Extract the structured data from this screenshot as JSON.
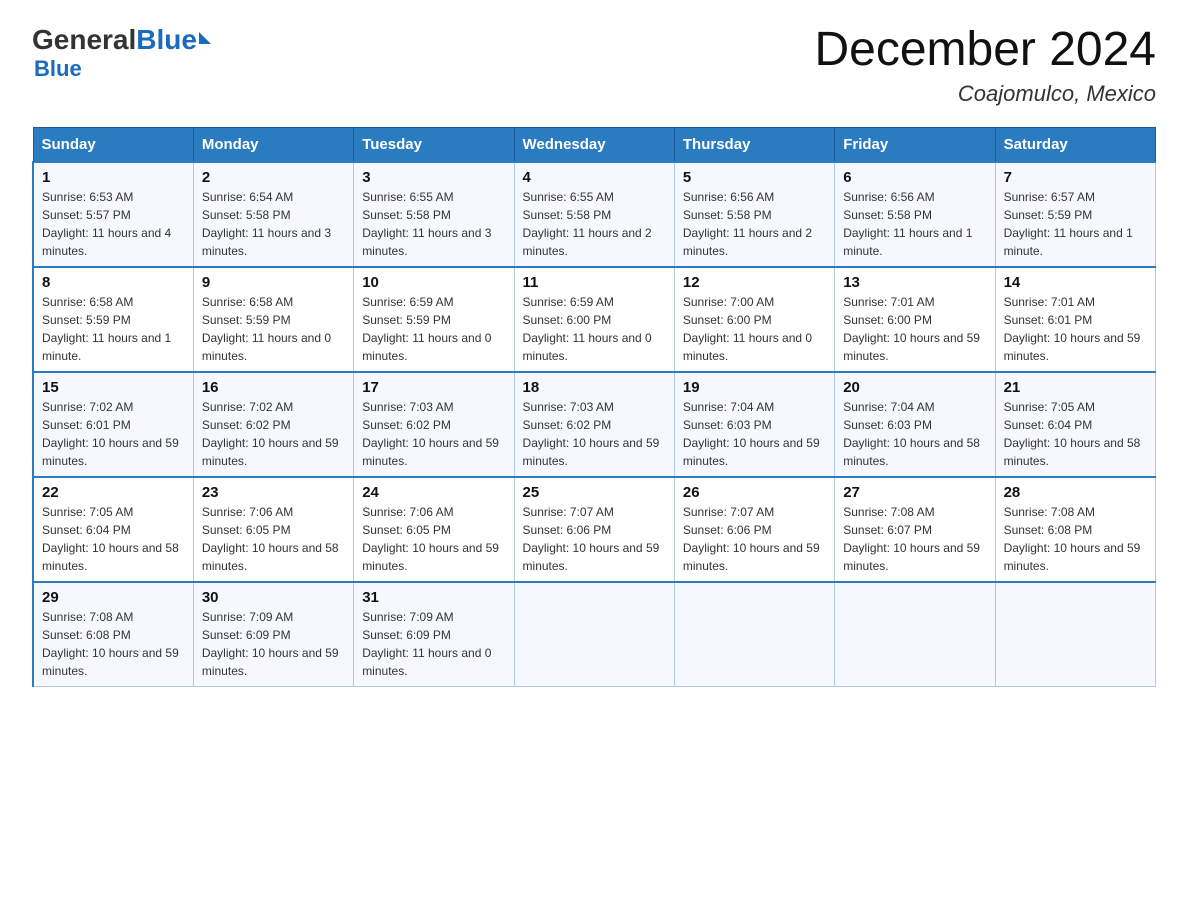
{
  "header": {
    "logo": {
      "general": "General",
      "blue": "Blue"
    },
    "title": "December 2024",
    "location": "Coajomulco, Mexico"
  },
  "days_of_week": [
    "Sunday",
    "Monday",
    "Tuesday",
    "Wednesday",
    "Thursday",
    "Friday",
    "Saturday"
  ],
  "weeks": [
    [
      {
        "day": "1",
        "sunrise": "6:53 AM",
        "sunset": "5:57 PM",
        "daylight": "11 hours and 4 minutes."
      },
      {
        "day": "2",
        "sunrise": "6:54 AM",
        "sunset": "5:58 PM",
        "daylight": "11 hours and 3 minutes."
      },
      {
        "day": "3",
        "sunrise": "6:55 AM",
        "sunset": "5:58 PM",
        "daylight": "11 hours and 3 minutes."
      },
      {
        "day": "4",
        "sunrise": "6:55 AM",
        "sunset": "5:58 PM",
        "daylight": "11 hours and 2 minutes."
      },
      {
        "day": "5",
        "sunrise": "6:56 AM",
        "sunset": "5:58 PM",
        "daylight": "11 hours and 2 minutes."
      },
      {
        "day": "6",
        "sunrise": "6:56 AM",
        "sunset": "5:58 PM",
        "daylight": "11 hours and 1 minute."
      },
      {
        "day": "7",
        "sunrise": "6:57 AM",
        "sunset": "5:59 PM",
        "daylight": "11 hours and 1 minute."
      }
    ],
    [
      {
        "day": "8",
        "sunrise": "6:58 AM",
        "sunset": "5:59 PM",
        "daylight": "11 hours and 1 minute."
      },
      {
        "day": "9",
        "sunrise": "6:58 AM",
        "sunset": "5:59 PM",
        "daylight": "11 hours and 0 minutes."
      },
      {
        "day": "10",
        "sunrise": "6:59 AM",
        "sunset": "5:59 PM",
        "daylight": "11 hours and 0 minutes."
      },
      {
        "day": "11",
        "sunrise": "6:59 AM",
        "sunset": "6:00 PM",
        "daylight": "11 hours and 0 minutes."
      },
      {
        "day": "12",
        "sunrise": "7:00 AM",
        "sunset": "6:00 PM",
        "daylight": "11 hours and 0 minutes."
      },
      {
        "day": "13",
        "sunrise": "7:01 AM",
        "sunset": "6:00 PM",
        "daylight": "10 hours and 59 minutes."
      },
      {
        "day": "14",
        "sunrise": "7:01 AM",
        "sunset": "6:01 PM",
        "daylight": "10 hours and 59 minutes."
      }
    ],
    [
      {
        "day": "15",
        "sunrise": "7:02 AM",
        "sunset": "6:01 PM",
        "daylight": "10 hours and 59 minutes."
      },
      {
        "day": "16",
        "sunrise": "7:02 AM",
        "sunset": "6:02 PM",
        "daylight": "10 hours and 59 minutes."
      },
      {
        "day": "17",
        "sunrise": "7:03 AM",
        "sunset": "6:02 PM",
        "daylight": "10 hours and 59 minutes."
      },
      {
        "day": "18",
        "sunrise": "7:03 AM",
        "sunset": "6:02 PM",
        "daylight": "10 hours and 59 minutes."
      },
      {
        "day": "19",
        "sunrise": "7:04 AM",
        "sunset": "6:03 PM",
        "daylight": "10 hours and 59 minutes."
      },
      {
        "day": "20",
        "sunrise": "7:04 AM",
        "sunset": "6:03 PM",
        "daylight": "10 hours and 58 minutes."
      },
      {
        "day": "21",
        "sunrise": "7:05 AM",
        "sunset": "6:04 PM",
        "daylight": "10 hours and 58 minutes."
      }
    ],
    [
      {
        "day": "22",
        "sunrise": "7:05 AM",
        "sunset": "6:04 PM",
        "daylight": "10 hours and 58 minutes."
      },
      {
        "day": "23",
        "sunrise": "7:06 AM",
        "sunset": "6:05 PM",
        "daylight": "10 hours and 58 minutes."
      },
      {
        "day": "24",
        "sunrise": "7:06 AM",
        "sunset": "6:05 PM",
        "daylight": "10 hours and 59 minutes."
      },
      {
        "day": "25",
        "sunrise": "7:07 AM",
        "sunset": "6:06 PM",
        "daylight": "10 hours and 59 minutes."
      },
      {
        "day": "26",
        "sunrise": "7:07 AM",
        "sunset": "6:06 PM",
        "daylight": "10 hours and 59 minutes."
      },
      {
        "day": "27",
        "sunrise": "7:08 AM",
        "sunset": "6:07 PM",
        "daylight": "10 hours and 59 minutes."
      },
      {
        "day": "28",
        "sunrise": "7:08 AM",
        "sunset": "6:08 PM",
        "daylight": "10 hours and 59 minutes."
      }
    ],
    [
      {
        "day": "29",
        "sunrise": "7:08 AM",
        "sunset": "6:08 PM",
        "daylight": "10 hours and 59 minutes."
      },
      {
        "day": "30",
        "sunrise": "7:09 AM",
        "sunset": "6:09 PM",
        "daylight": "10 hours and 59 minutes."
      },
      {
        "day": "31",
        "sunrise": "7:09 AM",
        "sunset": "6:09 PM",
        "daylight": "11 hours and 0 minutes."
      },
      null,
      null,
      null,
      null
    ]
  ]
}
